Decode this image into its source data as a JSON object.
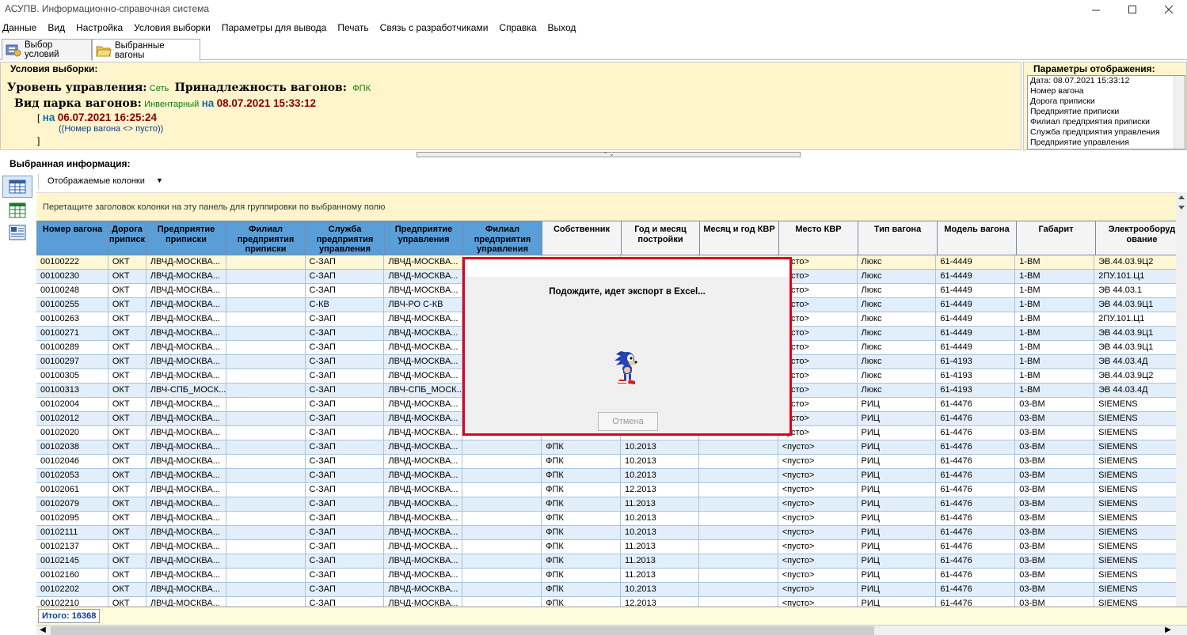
{
  "window": {
    "title": "АСУПВ. Информационно-справочная система"
  },
  "menu": [
    "Данные",
    "Вид",
    "Настройка",
    "Условия выборки",
    "Параметры для вывода",
    "Печать",
    "Связь с разработчиками",
    "Справка",
    "Выход"
  ],
  "tabs": [
    {
      "label": "Выбор условий"
    },
    {
      "label": "Выбранные вагоны"
    }
  ],
  "conditions": {
    "section_label": "Условия выборки:",
    "level_label": "Уровень управления:",
    "level_value": "Сеть",
    "ownership_label": "Принадлежность вагонов:",
    "ownership_value": "ФПК",
    "park_label": "Вид парка вагонов:",
    "park_value": "Инвентарный",
    "na": "на",
    "date1": "08.07.2021 15:33:12",
    "bracket_open": "[",
    "date2": "06.07.2021 16:25:24",
    "filter_text": "((Номер вагона <> пусто))",
    "bracket_close": "]"
  },
  "params": {
    "section_label": "Параметры отображения:",
    "items": [
      "Дата: 08.07.2021 15:33:12",
      "Номер вагона",
      "Дорога приписки",
      "Предприятие приписки",
      "Филиал предприятия приписки",
      "Служба предприятия управления",
      "Предприятие управления"
    ]
  },
  "info": {
    "section_label": "Выбранная информация:",
    "columns_button": "Отображаемые колонки",
    "group_hint": "Перетащите заголовок колонки на эту панель для группировки по выбранному полю"
  },
  "columns": [
    "Номер вагона",
    "Дорога приписк",
    "Предприятие приписки",
    "Филиал предприятия приписки",
    "Служба предприятия управления",
    "Предприятие управления",
    "Филиал предприятия управления",
    "Собственник",
    "Год и месяц постройки",
    "Месяц и год КВР",
    "Место КВР",
    "Тип вагона",
    "Модель вагона",
    "Габарит",
    "Электрооборуд ование"
  ],
  "rows": [
    [
      "00100222",
      "ОКТ",
      "ЛВЧД-МОСКВА...",
      "",
      "С-ЗАП",
      "ЛВЧД-МОСКВА...",
      "",
      "",
      "",
      "",
      "пусто>",
      "Люкс",
      "61-4449",
      "1-ВМ",
      "ЭВ.44.03.9Ц2"
    ],
    [
      "00100230",
      "ОКТ",
      "ЛВЧД-МОСКВА...",
      "",
      "С-ЗАП",
      "ЛВЧД-МОСКВА...",
      "",
      "",
      "",
      "",
      "пусто>",
      "Люкс",
      "61-4449",
      "1-ВМ",
      "2ПУ.101.Ц1"
    ],
    [
      "00100248",
      "ОКТ",
      "ЛВЧД-МОСКВА...",
      "",
      "С-ЗАП",
      "ЛВЧД-МОСКВА...",
      "",
      "",
      "",
      "",
      "пусто>",
      "Люкс",
      "61-4449",
      "1-ВМ",
      "ЭВ 44.03.1"
    ],
    [
      "00100255",
      "ОКТ",
      "ЛВЧД-МОСКВА...",
      "",
      "С-КВ",
      "ЛВЧ-РО С-КВ",
      "",
      "",
      "",
      "",
      "пусто>",
      "Люкс",
      "61-4449",
      "1-ВМ",
      "ЭВ 44.03.9Ц1"
    ],
    [
      "00100263",
      "ОКТ",
      "ЛВЧД-МОСКВА...",
      "",
      "С-ЗАП",
      "ЛВЧД-МОСКВА...",
      "",
      "",
      "",
      "",
      "пусто>",
      "Люкс",
      "61-4449",
      "1-ВМ",
      "2ПУ.101.Ц1"
    ],
    [
      "00100271",
      "ОКТ",
      "ЛВЧД-МОСКВА...",
      "",
      "С-ЗАП",
      "ЛВЧД-МОСКВА...",
      "",
      "",
      "",
      "",
      "пусто>",
      "Люкс",
      "61-4449",
      "1-ВМ",
      "ЭВ 44.03.9Ц1"
    ],
    [
      "00100289",
      "ОКТ",
      "ЛВЧД-МОСКВА...",
      "",
      "С-ЗАП",
      "ЛВЧД-МОСКВА...",
      "",
      "",
      "",
      "",
      "пусто>",
      "Люкс",
      "61-4449",
      "1-ВМ",
      "ЭВ 44.03.9Ц1"
    ],
    [
      "00100297",
      "ОКТ",
      "ЛВЧД-МОСКВА...",
      "",
      "С-ЗАП",
      "ЛВЧД-МОСКВА...",
      "",
      "",
      "",
      "",
      "пусто>",
      "Люкс",
      "61-4193",
      "1-ВМ",
      "ЭВ 44.03.4Д"
    ],
    [
      "00100305",
      "ОКТ",
      "ЛВЧД-МОСКВА...",
      "",
      "С-ЗАП",
      "ЛВЧД-МОСКВА...",
      "",
      "",
      "",
      "",
      "пусто>",
      "Люкс",
      "61-4193",
      "1-ВМ",
      "ЭВ.44.03.9Ц2"
    ],
    [
      "00100313",
      "ОКТ",
      "ЛВЧ-СПБ_МОСК...",
      "",
      "С-ЗАП",
      "ЛВЧ-СПБ_МОСК...",
      "",
      "",
      "",
      "",
      "пусто>",
      "Люкс",
      "61-4193",
      "1-ВМ",
      "ЭВ 44.03.4Д"
    ],
    [
      "00102004",
      "ОКТ",
      "ЛВЧД-МОСКВА...",
      "",
      "С-ЗАП",
      "ЛВЧД-МОСКВА...",
      "",
      "",
      "",
      "",
      "пусто>",
      "РИЦ",
      "61-4476",
      "03-ВМ",
      "SIEMENS"
    ],
    [
      "00102012",
      "ОКТ",
      "ЛВЧД-МОСКВА...",
      "",
      "С-ЗАП",
      "ЛВЧД-МОСКВА...",
      "",
      "",
      "",
      "",
      "пусто>",
      "РИЦ",
      "61-4476",
      "03-ВМ",
      "SIEMENS"
    ],
    [
      "00102020",
      "ОКТ",
      "ЛВЧД-МОСКВА...",
      "",
      "С-ЗАП",
      "ЛВЧД-МОСКВА...",
      "",
      "",
      "",
      "",
      "пусто>",
      "РИЦ",
      "61-4476",
      "03-ВМ",
      "SIEMENS"
    ],
    [
      "00102038",
      "ОКТ",
      "ЛВЧД-МОСКВА...",
      "",
      "С-ЗАП",
      "ЛВЧД-МОСКВА...",
      "",
      "ФПК",
      "10.2013",
      "",
      "<пусто>",
      "РИЦ",
      "61-4476",
      "03-ВМ",
      "SIEMENS"
    ],
    [
      "00102046",
      "ОКТ",
      "ЛВЧД-МОСКВА...",
      "",
      "С-ЗАП",
      "ЛВЧД-МОСКВА...",
      "",
      "ФПК",
      "10.2013",
      "",
      "<пусто>",
      "РИЦ",
      "61-4476",
      "03-ВМ",
      "SIEMENS"
    ],
    [
      "00102053",
      "ОКТ",
      "ЛВЧД-МОСКВА...",
      "",
      "С-ЗАП",
      "ЛВЧД-МОСКВА...",
      "",
      "ФПК",
      "10.2013",
      "",
      "<пусто>",
      "РИЦ",
      "61-4476",
      "03-ВМ",
      "SIEMENS"
    ],
    [
      "00102061",
      "ОКТ",
      "ЛВЧД-МОСКВА...",
      "",
      "С-ЗАП",
      "ЛВЧД-МОСКВА...",
      "",
      "ФПК",
      "12.2013",
      "",
      "<пусто>",
      "РИЦ",
      "61-4476",
      "03-ВМ",
      "SIEMENS"
    ],
    [
      "00102079",
      "ОКТ",
      "ЛВЧД-МОСКВА...",
      "",
      "С-ЗАП",
      "ЛВЧД-МОСКВА...",
      "",
      "ФПК",
      "11.2013",
      "",
      "<пусто>",
      "РИЦ",
      "61-4476",
      "03-ВМ",
      "SIEMENS"
    ],
    [
      "00102095",
      "ОКТ",
      "ЛВЧД-МОСКВА...",
      "",
      "С-ЗАП",
      "ЛВЧД-МОСКВА...",
      "",
      "ФПК",
      "10.2013",
      "",
      "<пусто>",
      "РИЦ",
      "61-4476",
      "03-ВМ",
      "SIEMENS"
    ],
    [
      "00102111",
      "ОКТ",
      "ЛВЧД-МОСКВА...",
      "",
      "С-ЗАП",
      "ЛВЧД-МОСКВА...",
      "",
      "ФПК",
      "10.2013",
      "",
      "<пусто>",
      "РИЦ",
      "61-4476",
      "03-ВМ",
      "SIEMENS"
    ],
    [
      "00102137",
      "ОКТ",
      "ЛВЧД-МОСКВА...",
      "",
      "С-ЗАП",
      "ЛВЧД-МОСКВА...",
      "",
      "ФПК",
      "11.2013",
      "",
      "<пусто>",
      "РИЦ",
      "61-4476",
      "03-ВМ",
      "SIEMENS"
    ],
    [
      "00102145",
      "ОКТ",
      "ЛВЧД-МОСКВА...",
      "",
      "С-ЗАП",
      "ЛВЧД-МОСКВА...",
      "",
      "ФПК",
      "11.2013",
      "",
      "<пусто>",
      "РИЦ",
      "61-4476",
      "03-ВМ",
      "SIEMENS"
    ],
    [
      "00102160",
      "ОКТ",
      "ЛВЧД-МОСКВА...",
      "",
      "С-ЗАП",
      "ЛВЧД-МОСКВА...",
      "",
      "ФПК",
      "11.2013",
      "",
      "<пусто>",
      "РИЦ",
      "61-4476",
      "03-ВМ",
      "SIEMENS"
    ],
    [
      "00102202",
      "ОКТ",
      "ЛВЧД-МОСКВА...",
      "",
      "С-ЗАП",
      "ЛВЧД-МОСКВА...",
      "",
      "ФПК",
      "10.2013",
      "",
      "<пусто>",
      "РИЦ",
      "61-4476",
      "03-ВМ",
      "SIEMENS"
    ],
    [
      "00102210",
      "ОКТ",
      "ЛВЧД-МОСКВА...",
      "",
      "С-ЗАП",
      "ЛВЧД-МОСКВА...",
      "",
      "ФПК",
      "12.2013",
      "",
      "<пусто>",
      "РИЦ",
      "61-4476",
      "03-ВМ",
      "SIEMENS"
    ]
  ],
  "footer": {
    "total": "Итого: 16368"
  },
  "modal": {
    "message": "Подождите, идет экспорт в Excel...",
    "cancel_label": "Отмена"
  },
  "icons": {
    "tab1": "conditions-icon",
    "tab2": "folder-icon",
    "left1": "grid-view-icon",
    "left2": "excel-icon",
    "left3": "card-view-icon"
  },
  "colors": {
    "panel_bg": "#fff5cc",
    "row_alt": "#e2eef9",
    "header_highlight": "#5a9ed8",
    "modal_border": "#e0001a"
  }
}
